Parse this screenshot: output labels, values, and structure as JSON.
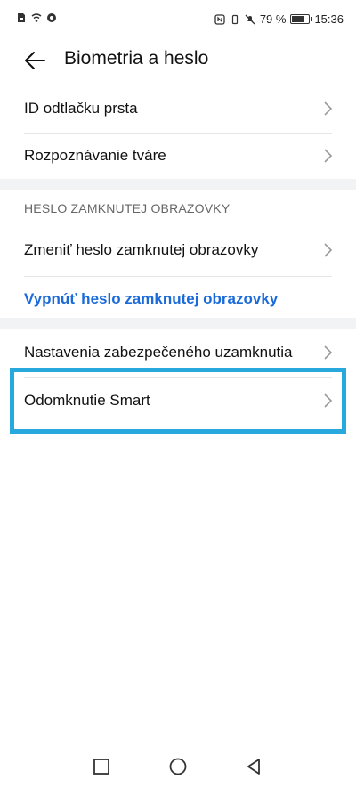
{
  "status_bar": {
    "battery_percent": "79 %",
    "time": "15:36",
    "battery_level": 0.79,
    "left_icons": [
      "sim-icon",
      "wifi-icon",
      "data-icon"
    ],
    "right_icons": [
      "nfc-icon",
      "vibrate-icon",
      "mute-icon"
    ]
  },
  "header": {
    "title": "Biometria a heslo"
  },
  "settings": {
    "fingerprint": "ID odtlačku prsta",
    "face": "Rozpoznávanie tváre",
    "section_title": "HESLO ZAMKNUTEJ OBRAZOVKY",
    "change_password": "Zmeniť heslo zamknutej obrazovky",
    "disable_password": "Vypnúť heslo zamknutej obrazovky",
    "secure_lock": "Nastavenia zabezpečeného uzamknutia",
    "smart_unlock": "Odomknutie Smart"
  },
  "colors": {
    "accent_link": "#1a6ad9",
    "highlight": "#27a9dd",
    "section_gap": "#f1f3f5"
  }
}
